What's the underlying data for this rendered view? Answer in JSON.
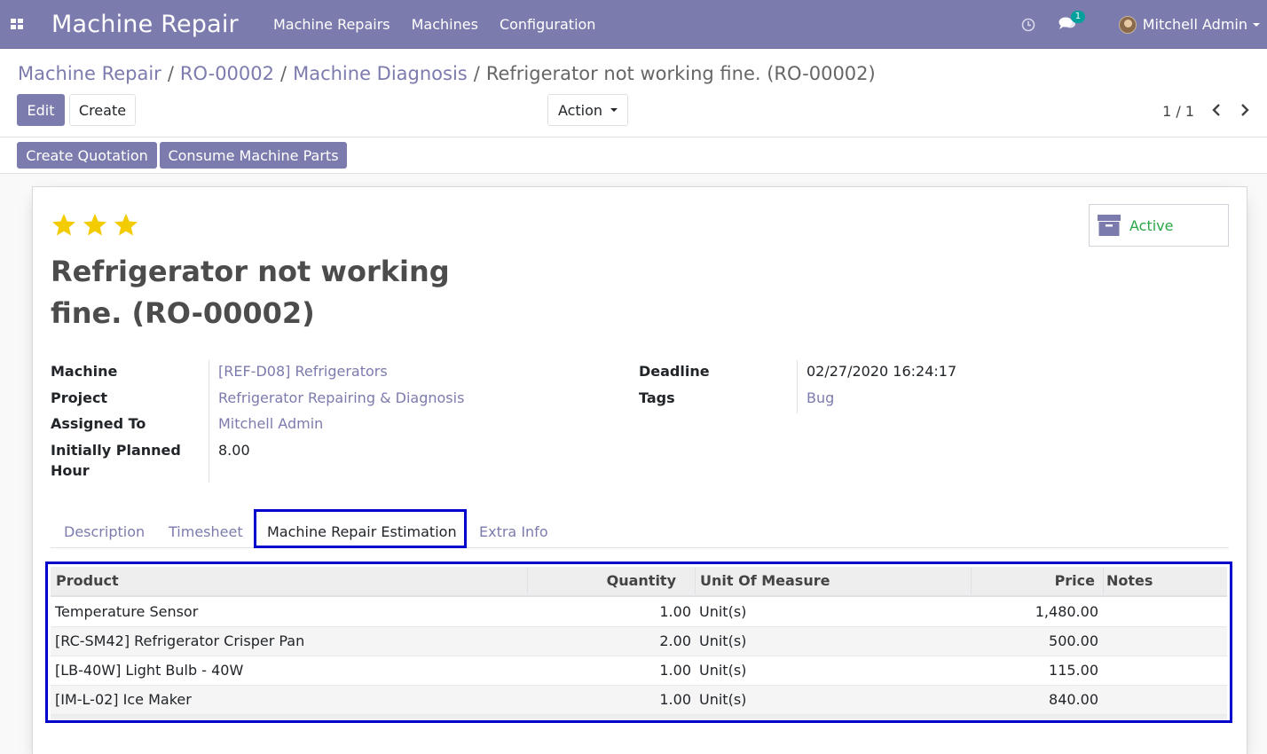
{
  "navbar": {
    "brand": "Machine Repair",
    "menu": [
      "Machine Repairs",
      "Machines",
      "Configuration"
    ],
    "chat_count": "1",
    "user_name": "Mitchell Admin"
  },
  "control_panel": {
    "breadcrumb": [
      "Machine Repair",
      "RO-00002",
      "Machine Diagnosis",
      "Refrigerator not working fine. (RO-00002)"
    ],
    "edit_label": "Edit",
    "create_label": "Create",
    "action_label": "Action",
    "pager": "1 / 1"
  },
  "statusbar": {
    "create_quotation": "Create Quotation",
    "consume_parts": "Consume Machine Parts"
  },
  "form": {
    "priority_stars": 3,
    "active_label": "Active",
    "title": "Refrigerator not working fine. (RO-00002)",
    "left_fields": [
      {
        "label": "Machine",
        "value": "[REF-D08] Refrigerators"
      },
      {
        "label": "Project",
        "value": "Refrigerator Repairing & Diagnosis"
      },
      {
        "label": "Assigned To",
        "value": "Mitchell Admin"
      },
      {
        "label": "Initially Planned Hour",
        "value": "8.00"
      }
    ],
    "right_fields": [
      {
        "label": "Deadline",
        "value": "02/27/2020 16:24:17"
      },
      {
        "label": "Tags",
        "value": "Bug"
      }
    ],
    "tabs": [
      "Description",
      "Timesheet",
      "Machine Repair Estimation",
      "Extra Info"
    ],
    "active_tab": "Machine Repair Estimation"
  },
  "table": {
    "headers": [
      "Product",
      "Quantity",
      "Unit Of Measure",
      "Price",
      "Notes"
    ],
    "rows": [
      [
        "Temperature Sensor",
        "1.00",
        "Unit(s)",
        "1,480.00",
        ""
      ],
      [
        "[RC-SM42] Refrigerator Crisper Pan",
        "2.00",
        "Unit(s)",
        "500.00",
        ""
      ],
      [
        "[LB-40W] Light Bulb - 40W",
        "1.00",
        "Unit(s)",
        "115.00",
        ""
      ],
      [
        "[IM-L-02] Ice Maker",
        "1.00",
        "Unit(s)",
        "840.00",
        ""
      ]
    ]
  },
  "colors": {
    "brand": "#7c7bad",
    "active_status": "#28a745",
    "star": "#f3cc00",
    "highlight_border": "#0000cc"
  },
  "icons": [
    "apps-grid-icon",
    "clock-icon",
    "chat-icon",
    "avatar",
    "caret-down-icon",
    "chevron-left-icon",
    "chevron-right-icon",
    "star-icon",
    "archive-icon"
  ]
}
